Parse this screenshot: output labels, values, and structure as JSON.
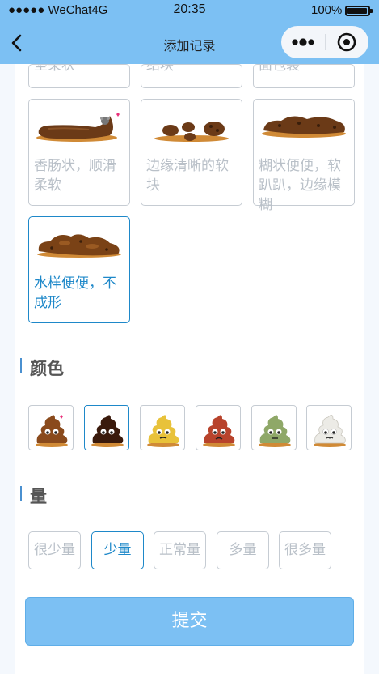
{
  "status_bar": {
    "carrier": "●●●●● WeChat4G",
    "time": "20:35",
    "battery": "100%"
  },
  "nav": {
    "title": "添加记录",
    "back_icon": "chevron-left-icon",
    "more_icon": "more-dots-icon",
    "close_icon": "target-close-icon",
    "bar_color": "#7cc0f3"
  },
  "stool_types": [
    {
      "label": "坚果状",
      "selected": false,
      "visible": "partial"
    },
    {
      "label": "结块",
      "selected": false,
      "visible": "partial"
    },
    {
      "label": "面包裂",
      "selected": false,
      "visible": "partial"
    },
    {
      "label": "香肠状，顺滑柔软",
      "selected": false
    },
    {
      "label": "边缘清晰的软块",
      "selected": false
    },
    {
      "label": "糊状便便，软趴趴，边缘模糊",
      "selected": false
    },
    {
      "label": "水样便便，不成形",
      "selected": true
    }
  ],
  "color_section": {
    "title": "颜色",
    "swatches": [
      {
        "name": "brown",
        "hex": "#8a4a1c",
        "selected": false
      },
      {
        "name": "dark-brown",
        "hex": "#3a1a0c",
        "selected": true
      },
      {
        "name": "yellow",
        "hex": "#e8c23a",
        "selected": false
      },
      {
        "name": "red",
        "hex": "#b8432c",
        "selected": false
      },
      {
        "name": "green",
        "hex": "#8fa868",
        "selected": false
      },
      {
        "name": "white",
        "hex": "#ecebe6",
        "selected": false
      }
    ]
  },
  "amount_section": {
    "title": "量",
    "options": [
      {
        "label": "很少量",
        "selected": false
      },
      {
        "label": "少量",
        "selected": true
      },
      {
        "label": "正常量",
        "selected": false
      },
      {
        "label": "多量",
        "selected": false
      },
      {
        "label": "很多量",
        "selected": false
      }
    ]
  },
  "submit": {
    "label": "提交"
  },
  "colors": {
    "accent": "#1e88c9",
    "primary": "#7cc0f3",
    "muted_text": "#b9c0c8",
    "border": "#c6ccd3"
  }
}
